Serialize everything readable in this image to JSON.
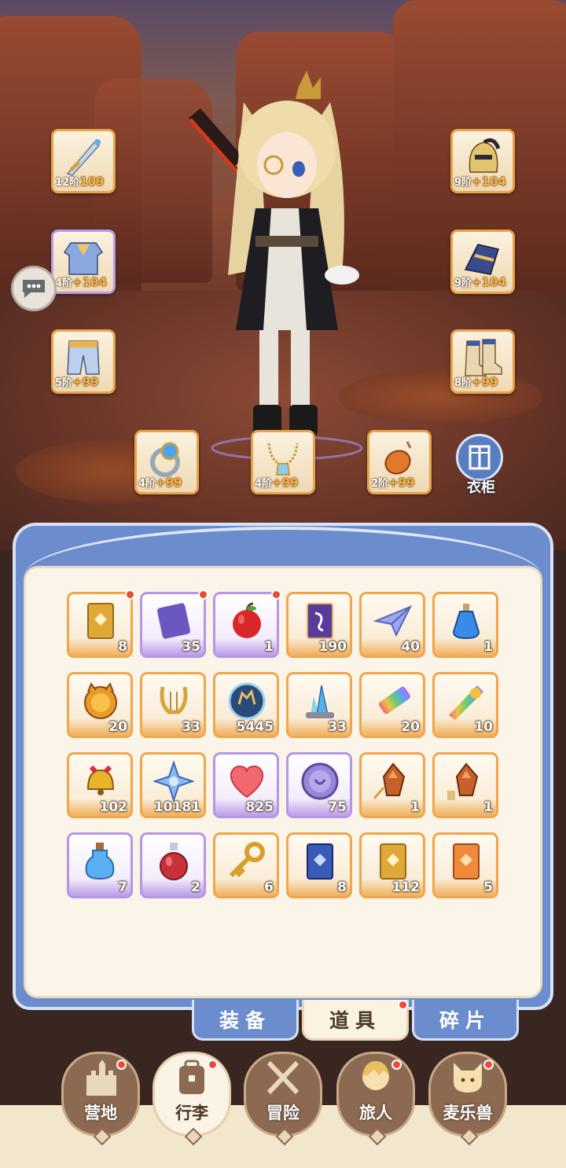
{
  "equipment": {
    "left": [
      {
        "name": "weapon",
        "tier": "12阶",
        "level": "109"
      },
      {
        "name": "armor",
        "tier": "4阶",
        "level": "+104"
      },
      {
        "name": "pants",
        "tier": "5阶",
        "level": "+99"
      }
    ],
    "right": [
      {
        "name": "helmet",
        "tier": "9阶",
        "level": "+104"
      },
      {
        "name": "gloves",
        "tier": "9阶",
        "level": "+104"
      },
      {
        "name": "boots",
        "tier": "8阶",
        "level": "+99"
      }
    ],
    "accessories": [
      {
        "name": "ring",
        "tier": "4阶",
        "level": "+99"
      },
      {
        "name": "necklace",
        "tier": "4阶",
        "level": "+99"
      },
      {
        "name": "charm",
        "tier": "2阶",
        "level": "+99"
      }
    ]
  },
  "wardrobe_label": "衣柜",
  "items": [
    {
      "icon": "gold-card-icon",
      "count": "8",
      "rarity": "orange",
      "dot": true
    },
    {
      "icon": "moon-scroll-icon",
      "count": "35",
      "rarity": "purple",
      "dot": true
    },
    {
      "icon": "apple-icon",
      "count": "1",
      "rarity": "purple",
      "dot": true
    },
    {
      "icon": "purple-ticket-icon",
      "count": "190",
      "rarity": "orange",
      "dot": false
    },
    {
      "icon": "paper-plane-icon",
      "count": "40",
      "rarity": "orange",
      "dot": false
    },
    {
      "icon": "blue-potion-icon",
      "count": "1",
      "rarity": "orange",
      "dot": false
    },
    {
      "icon": "fox-coin-icon",
      "count": "20",
      "rarity": "orange",
      "dot": false
    },
    {
      "icon": "lyre-icon",
      "count": "33",
      "rarity": "orange",
      "dot": false
    },
    {
      "icon": "bubble-orb-icon",
      "count": "5445",
      "rarity": "orange",
      "dot": false
    },
    {
      "icon": "crystal-cluster-icon",
      "count": "33",
      "rarity": "orange",
      "dot": false
    },
    {
      "icon": "rainbow-tube-icon",
      "count": "20",
      "rarity": "orange",
      "dot": false
    },
    {
      "icon": "rainbow-paint-icon",
      "count": "10",
      "rarity": "orange",
      "dot": false
    },
    {
      "icon": "bell-icon",
      "count": "102",
      "rarity": "orange",
      "dot": false
    },
    {
      "icon": "star-crystal-icon",
      "count": "10181",
      "rarity": "orange",
      "dot": false
    },
    {
      "icon": "heart-icon",
      "count": "825",
      "rarity": "purple",
      "dot": false
    },
    {
      "icon": "purple-coin-icon",
      "count": "75",
      "rarity": "purple",
      "dot": false
    },
    {
      "icon": "weapon-ore-icon",
      "count": "1",
      "rarity": "orange",
      "dot": false
    },
    {
      "icon": "boot-ore-icon",
      "count": "1",
      "rarity": "orange",
      "dot": false
    },
    {
      "icon": "blue-bottle-icon",
      "count": "7",
      "rarity": "purple",
      "dot": false
    },
    {
      "icon": "red-flask-icon",
      "count": "2",
      "rarity": "purple",
      "dot": false
    },
    {
      "icon": "gold-key-icon",
      "count": "6",
      "rarity": "orange",
      "dot": false
    },
    {
      "icon": "blue-card-icon",
      "count": "8",
      "rarity": "orange",
      "dot": false
    },
    {
      "icon": "gold-card-icon",
      "count": "112",
      "rarity": "orange",
      "dot": false
    },
    {
      "icon": "orange-card-icon",
      "count": "5",
      "rarity": "orange",
      "dot": false
    }
  ],
  "tabs": {
    "equipment": "装备",
    "items": "道具",
    "fragments": "碎片"
  },
  "nav": [
    {
      "label": "营地",
      "icon": "castle-icon",
      "dot": true
    },
    {
      "label": "行李",
      "icon": "backpack-icon",
      "dot": true
    },
    {
      "label": "冒险",
      "icon": "crossed-swords-icon",
      "dot": false
    },
    {
      "label": "旅人",
      "icon": "traveler-icon",
      "dot": true
    },
    {
      "label": "麦乐兽",
      "icon": "cat-icon",
      "dot": true
    }
  ],
  "colors": {
    "orange_border": "#f0a64a",
    "purple_border": "#b596e6",
    "panel_blue": "#6b8ccd",
    "red_dot": "#ee4a38"
  }
}
